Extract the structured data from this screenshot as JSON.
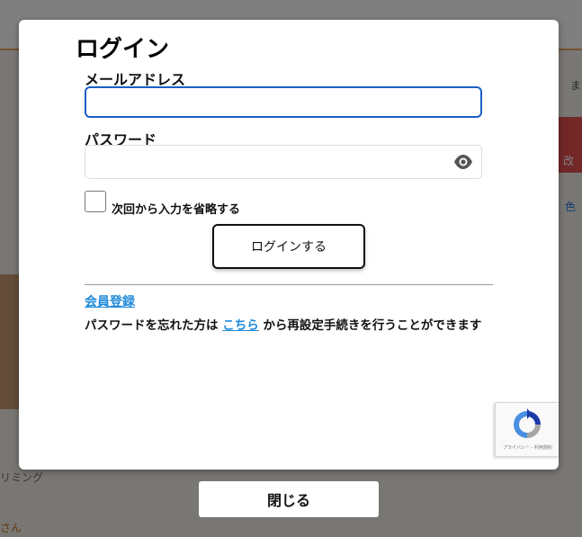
{
  "modal": {
    "title": "ログイン",
    "email": {
      "label": "メールアドレス",
      "value": "",
      "placeholder": ""
    },
    "password": {
      "label": "パスワード",
      "value": "",
      "placeholder": "",
      "toggle_icon": "eye-icon"
    },
    "remember": {
      "label": "次回から入力を省略する",
      "checked": false
    },
    "login_button": "ログインする",
    "register_link": "会員登録",
    "forgot": {
      "prefix": "パスワードを忘れた方は ",
      "link": "こちら",
      "suffix": " から再設定手続きを行うことができます"
    },
    "recaptcha": {
      "icon": "recaptcha-icon",
      "text": "プライバシー - 利用規約"
    }
  },
  "close_button": "閉じる",
  "background": {
    "text_right_1": "ま",
    "text_right_2": "改",
    "text_right_3": "色",
    "text_left_1": "リミング",
    "text_left_2": "さん"
  },
  "colors": {
    "overlay": "rgba(0,0,0,0.5)",
    "link": "#1f8ad8",
    "focus_border": "#1a5fc4",
    "accent_red": "#e2504f"
  }
}
